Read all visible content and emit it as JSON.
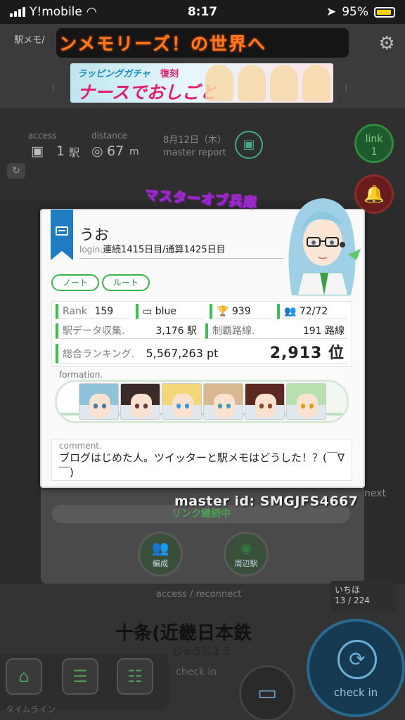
{
  "status_bar": {
    "carrier": "Y!mobile",
    "time": "8:17",
    "battery": "95%"
  },
  "header": {
    "app_logo": "駅メモ/",
    "marquee_text": "ンメモリーズ！の世界へ",
    "banner": {
      "line1": "ラッピングガチャ",
      "badge": "復刻",
      "main": "ナースでおしごと"
    }
  },
  "stats": {
    "access_label": "access",
    "access_value": "1",
    "access_unit": "駅",
    "distance_label": "distance",
    "distance_value": "67",
    "distance_unit": "m",
    "date": "8月12日（木）",
    "report": "master report",
    "link_label": "link",
    "link_value": "1"
  },
  "profile": {
    "title_badge": "マスターオブ兵庫",
    "name": "うお",
    "login_label": "login.",
    "login_text": "連続1415日目/通算1425日目",
    "buttons": {
      "note": "ノート",
      "route": "ルート"
    },
    "rank_label": "Rank",
    "rank_value": "159",
    "color": "blue",
    "trophies": "939",
    "denko_count": "72/72",
    "station_data_label": "駅データ収集.",
    "station_data_value": "3,176 駅",
    "lines_label": "制覇路線.",
    "lines_value": "191 路線",
    "ranking_label": "総合ランキング.",
    "ranking_points": "5,567,263 pt",
    "ranking_position": "2,913 位",
    "formation_label": "formation.",
    "formation": [
      {
        "hair": "#8fc3dc",
        "eye": "#4a7aa0"
      },
      {
        "hair": "#3a2a2a",
        "eye": "#6a3a3a"
      },
      {
        "hair": "#f2d678",
        "eye": "#3a9ad8"
      },
      {
        "hair": "#d8b890",
        "eye": "#3aa0b0"
      },
      {
        "hair": "#5a2a22",
        "eye": "#8a4a2a"
      },
      {
        "hair": "#b8e0b0",
        "eye": "#d8a020"
      }
    ],
    "comment_label": "comment.",
    "comment_text": "ブログはじめた人。ツイッターと駅メモはどうした！？(￣∇￣)",
    "master_id": "master id: SMGJFS4667"
  },
  "lower": {
    "link_continue": "リンク継続中",
    "formation_btn": "編成",
    "nearby_btn": "周辺駅",
    "access_reconnect": "access / reconnect",
    "station_name": "十条(近畿日本鉄",
    "station_kana": "じゅうじょう",
    "ichiho": "いちほ",
    "ichiho_count": "13 / 224",
    "next": "next",
    "checkin": "check in",
    "checkin_sub": "check in",
    "timeline": "タイムライン"
  },
  "colors": {
    "accent_green": "#3bc150",
    "bookmark_blue": "#1f7bc2",
    "title_purple": "#9a28c8"
  }
}
